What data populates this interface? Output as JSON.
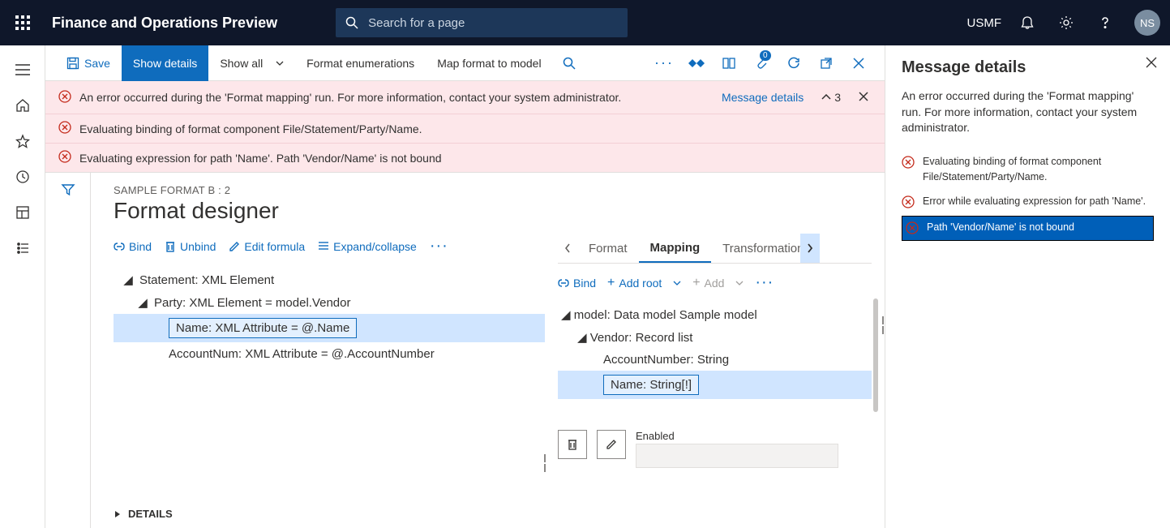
{
  "header": {
    "app_title": "Finance and Operations Preview",
    "search_placeholder": "Search for a page",
    "company": "USMF",
    "avatar": "NS"
  },
  "toolbar": {
    "save": "Save",
    "show_details": "Show details",
    "show_all": "Show all",
    "format_enum": "Format enumerations",
    "map_format": "Map format to model",
    "badge": "0"
  },
  "errors": {
    "rows": [
      "An error occurred during the 'Format mapping' run. For more information, contact your system administrator.",
      "Evaluating binding of format component File/Statement/Party/Name.",
      "Evaluating expression for path 'Name'.   Path 'Vendor/Name' is not bound"
    ],
    "details_link": "Message details",
    "count": "3"
  },
  "page": {
    "breadcrumb": "SAMPLE FORMAT B : 2",
    "title": "Format designer"
  },
  "left_actions": {
    "bind": "Bind",
    "unbind": "Unbind",
    "edit": "Edit formula",
    "expand": "Expand/collapse"
  },
  "left_tree": {
    "statement": "Statement: XML Element",
    "party": "Party: XML Element = model.Vendor",
    "name": "Name: XML Attribute = @.Name",
    "account": "AccountNum: XML Attribute = @.AccountNumber",
    "details": "DETAILS"
  },
  "tabs": {
    "format": "Format",
    "mapping": "Mapping",
    "transform": "Transformations"
  },
  "right_actions": {
    "bind": "Bind",
    "add_root": "Add root",
    "add": "Add"
  },
  "map_tree": {
    "model": "model: Data model Sample model",
    "vendor": "Vendor: Record list",
    "account": "AccountNumber: String",
    "name": "Name: String[!]"
  },
  "field": {
    "label": "Enabled"
  },
  "panel": {
    "title": "Message details",
    "desc": "An error occurred during the 'Format mapping' run. For more information, contact your system administrator.",
    "msgs": [
      "Evaluating binding of format component File/Statement/Party/Name.",
      "Error while evaluating expression for path 'Name'.",
      "Path 'Vendor/Name' is not bound"
    ]
  }
}
